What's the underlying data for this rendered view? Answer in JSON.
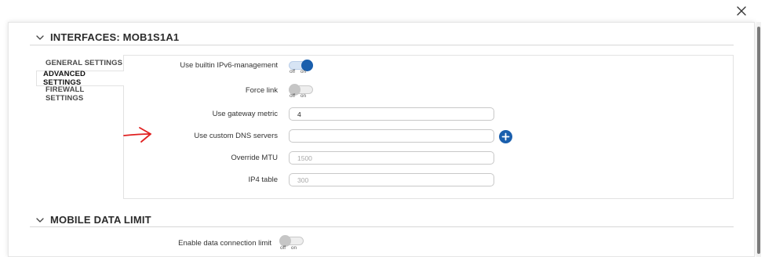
{
  "sections": {
    "interfaces": {
      "title": "INTERFACES: MOB1S1A1"
    },
    "mobile": {
      "title": "MOBILE DATA LIMIT"
    }
  },
  "tabs": [
    {
      "label": "GENERAL SETTINGS",
      "active": false
    },
    {
      "label": "ADVANCED SETTINGS",
      "active": true
    },
    {
      "label": "FIREWALL SETTINGS",
      "active": false
    }
  ],
  "fields": {
    "ipv6": {
      "label": "Use builtin IPv6-management",
      "state": "on",
      "off_text": "off",
      "on_text": "on"
    },
    "force_link": {
      "label": "Force link",
      "state": "off",
      "off_text": "off",
      "on_text": "on"
    },
    "gateway_metric": {
      "label": "Use gateway metric",
      "value": "4"
    },
    "custom_dns": {
      "label": "Use custom DNS servers",
      "value": ""
    },
    "override_mtu": {
      "label": "Override MTU",
      "placeholder": "1500"
    },
    "ip4_table": {
      "label": "IP4 table",
      "placeholder": "300"
    },
    "data_limit": {
      "label": "Enable data connection limit",
      "state": "off",
      "off_text": "off",
      "on_text": "on"
    }
  },
  "icons": {
    "close": "close-icon",
    "chevron": "chevron-down-icon",
    "add": "plus-icon",
    "annotation": "red-arrow-annotation"
  },
  "colors": {
    "accent": "#1a5fad",
    "annotation": "#e02020"
  }
}
